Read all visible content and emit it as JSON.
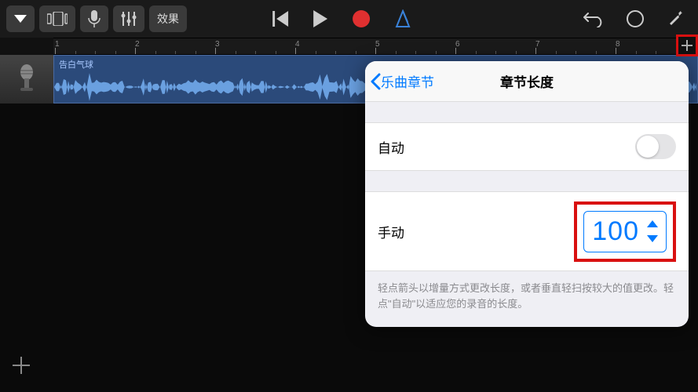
{
  "toolbar": {
    "effects_label": "效果"
  },
  "ruler": {
    "marks": [
      "1",
      "2",
      "3",
      "4",
      "5",
      "6",
      "7",
      "8"
    ]
  },
  "track": {
    "clip_title": "告白气球"
  },
  "popover": {
    "back_label": "乐曲章节",
    "title": "章节长度",
    "auto_label": "自动",
    "manual_label": "手动",
    "manual_value": "100",
    "hint": "轻点箭头以增量方式更改长度，或者垂直轻扫按较大的值更改。轻点\"自动\"以适应您的录音的长度。"
  }
}
